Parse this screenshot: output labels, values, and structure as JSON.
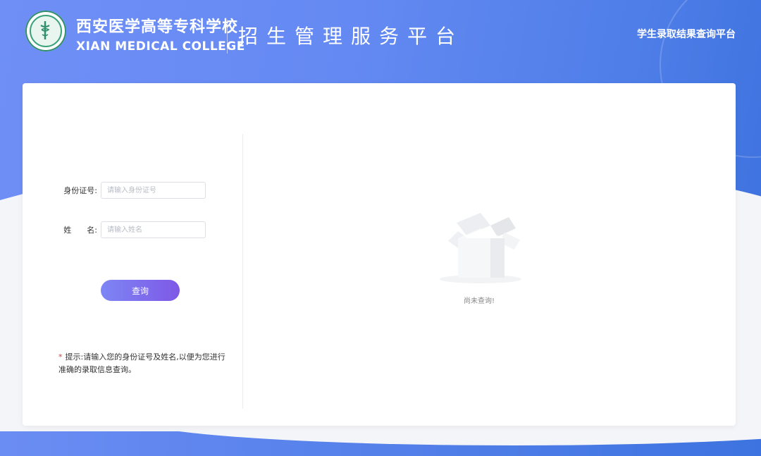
{
  "header": {
    "school_name_cn": "西安医学高等专科学校",
    "school_name_en": "XIAN MEDICAL COLLEGE",
    "platform_title": "招生管理服务平台",
    "top_link": "学生录取结果查询平台"
  },
  "form": {
    "id_label": "身份证号:",
    "id_placeholder": "请输入身份证号",
    "id_value": "",
    "name_label": "姓　　名:",
    "name_placeholder": "请输入姓名",
    "name_value": "",
    "query_button": "查询"
  },
  "hint": {
    "star": "*",
    "text": "提示:请输入您的身份证号及姓名,以便为您进行准确的录取信息查询。"
  },
  "result": {
    "empty_text": "尚未查询!"
  },
  "colors": {
    "header_blue": "#6489f2",
    "button_start": "#7d86f4",
    "button_end": "#7f58e6",
    "required_star": "#e53935"
  },
  "icons": {
    "logo": "school-emblem-icon",
    "empty": "empty-box-icon"
  }
}
